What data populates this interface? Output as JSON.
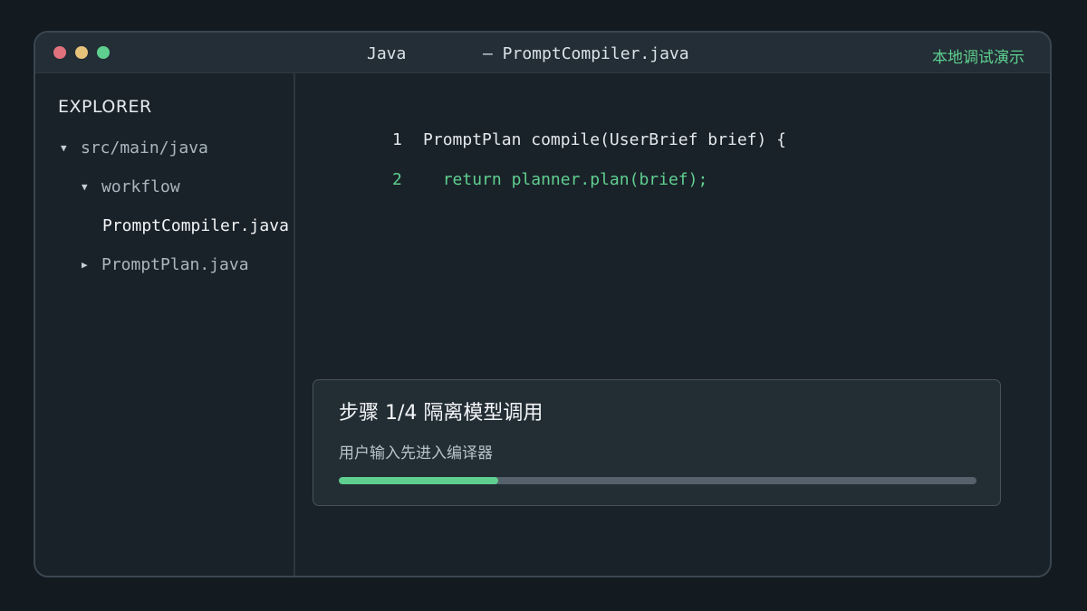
{
  "colors": {
    "accent": "#5fcf8f",
    "close_dot": "#e0727d",
    "min_dot": "#e6c27a",
    "max_dot": "#5fcf8f"
  },
  "titlebar": {
    "language": "Java",
    "file_title": "— PromptCompiler.java",
    "badge": "本地调试演示"
  },
  "sidebar": {
    "title": "EXPLORER",
    "items": [
      {
        "label": "src/main/java",
        "icon": "caret-down-icon",
        "caret": "▼"
      },
      {
        "label": "workflow",
        "icon": "caret-down-icon",
        "caret": "▼"
      },
      {
        "label": "PromptCompiler.java"
      },
      {
        "label": "PromptPlan.java",
        "icon": "caret-right-icon",
        "caret": "▶"
      }
    ]
  },
  "editor": {
    "lines": [
      {
        "number": "1",
        "code": "PromptPlan compile(UserBrief brief) {"
      },
      {
        "number": "2",
        "code": "  return planner.plan(brief);"
      }
    ]
  },
  "step_card": {
    "title": "步骤 1/4 隔离模型调用",
    "description": "用户输入先进入编译器",
    "progress": 0.25
  }
}
